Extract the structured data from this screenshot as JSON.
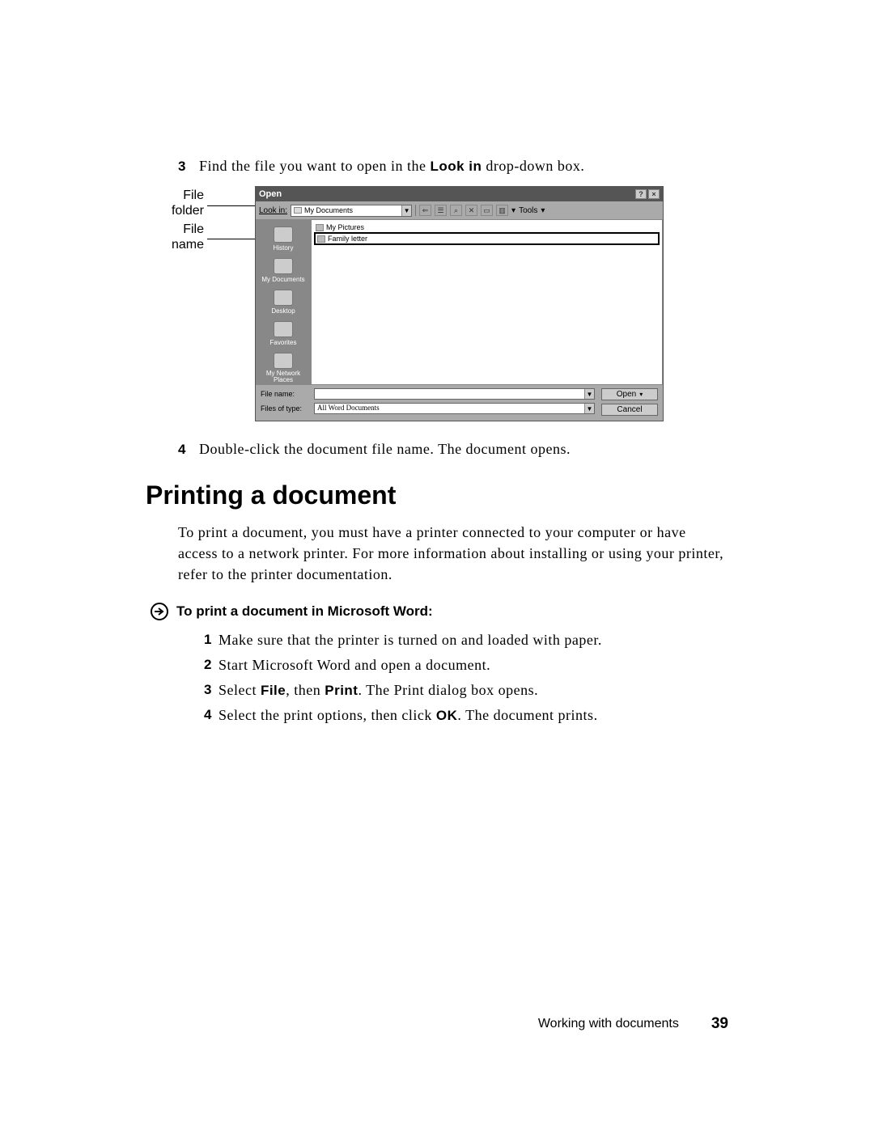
{
  "step3": {
    "num": "3",
    "pre": "Find the file you want to open in the ",
    "bold": "Look in",
    "post": " drop-down box."
  },
  "callouts": {
    "folder": "File\nfolder",
    "name": "File\nname"
  },
  "dialog": {
    "title": "Open",
    "lookin_label": "Look in:",
    "lookin_value": "My Documents",
    "toolbar_tools": "Tools",
    "places": [
      "History",
      "My Documents",
      "Desktop",
      "Favorites",
      "My Network Places"
    ],
    "files": [
      "My Pictures",
      "Family letter"
    ],
    "filename_label": "File name:",
    "filename_value": "",
    "filetype_label": "Files of type:",
    "filetype_value": "All Word Documents",
    "open_btn": "Open",
    "cancel_btn": "Cancel"
  },
  "step4": {
    "num": "4",
    "text": "Double-click the document file name. The document opens."
  },
  "heading": "Printing a document",
  "para": "To print a document, you must have a printer connected to your computer or have access to a network printer. For more information about installing or using your printer, refer to the printer documentation.",
  "sub_heading": "To print a document in Microsoft Word:",
  "print_steps": [
    {
      "num": "1",
      "parts": [
        {
          "t": "Make sure that the printer is turned on and loaded with paper."
        }
      ]
    },
    {
      "num": "2",
      "parts": [
        {
          "t": "Start Microsoft Word and open a document."
        }
      ]
    },
    {
      "num": "3",
      "parts": [
        {
          "t": "Select "
        },
        {
          "b": "File"
        },
        {
          "t": ", then "
        },
        {
          "b": "Print"
        },
        {
          "t": ". The Print dialog box opens."
        }
      ]
    },
    {
      "num": "4",
      "parts": [
        {
          "t": "Select the print options, then click "
        },
        {
          "b": "OK"
        },
        {
          "t": ". The document prints."
        }
      ]
    }
  ],
  "footer": {
    "chapter": "Working with documents",
    "page": "39"
  }
}
